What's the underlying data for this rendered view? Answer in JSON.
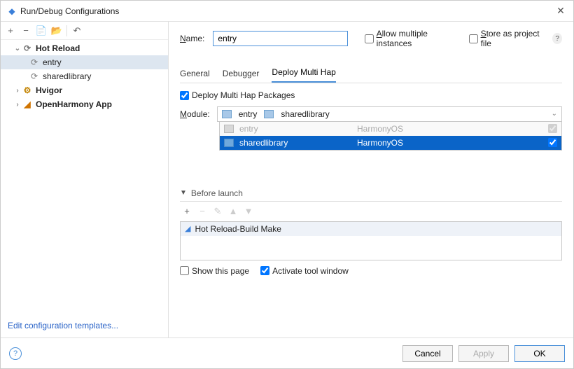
{
  "window": {
    "title": "Run/Debug Configurations"
  },
  "toolbar_icons": {
    "add": "+",
    "remove": "−",
    "copy": "📄",
    "folder": "📂",
    "rollback": "↶"
  },
  "tree": {
    "hotreload": {
      "label": "Hot Reload",
      "entry": "entry",
      "shared": "sharedlibrary"
    },
    "hvigor": "Hvigor",
    "openharmony": "OpenHarmony App"
  },
  "edit_templates": "Edit configuration templates...",
  "form": {
    "name_label": "Name:",
    "name_value": "entry",
    "allow_multiple": "Allow multiple instances",
    "store_as_project": "Store as project file"
  },
  "tabs": {
    "general": "General",
    "debugger": "Debugger",
    "deploy": "Deploy Multi Hap"
  },
  "deploy": {
    "checkbox": "Deploy Multi Hap Packages",
    "module_label": "Module:",
    "selected_a": "entry",
    "selected_b": "sharedlibrary",
    "rows": [
      {
        "name": "entry",
        "os": "HarmonyOS"
      },
      {
        "name": "sharedlibrary",
        "os": "HarmonyOS"
      }
    ]
  },
  "before_launch": {
    "header": "Before launch",
    "task": "Hot Reload-Build Make",
    "show_this_page": "Show this page",
    "activate_tool": "Activate tool window"
  },
  "buttons": {
    "cancel": "Cancel",
    "apply": "Apply",
    "ok": "OK"
  }
}
